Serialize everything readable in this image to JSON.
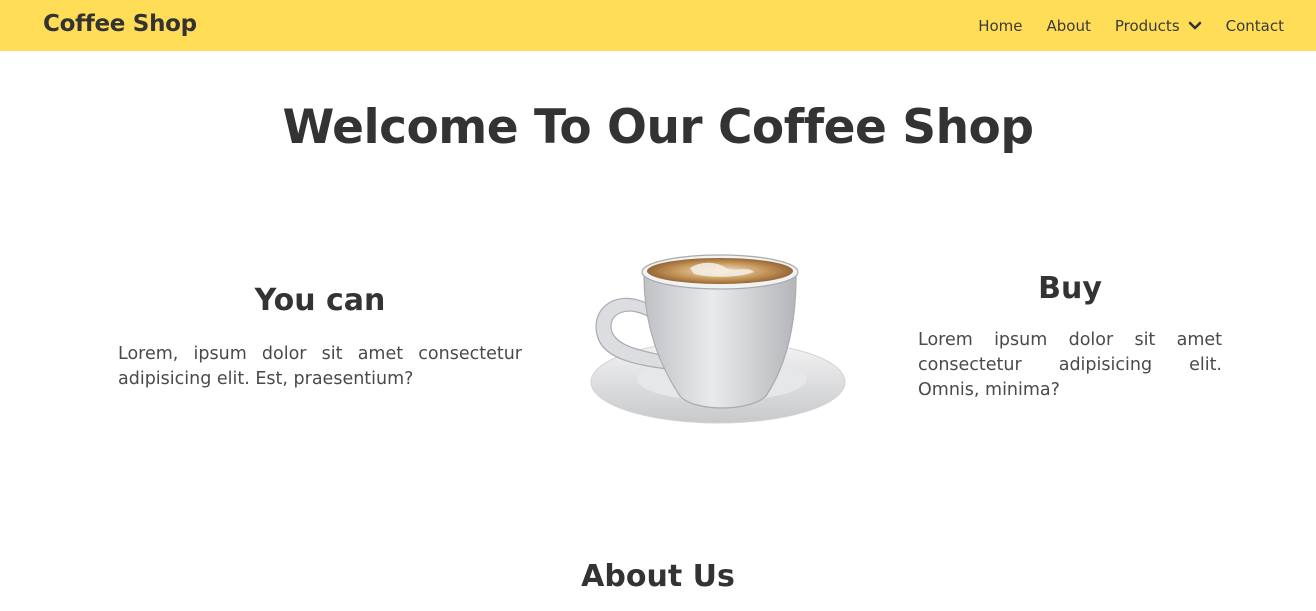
{
  "nav": {
    "brand": "Coffee Shop",
    "links": [
      {
        "label": "Home"
      },
      {
        "label": "About"
      },
      {
        "label": "Products",
        "icon": "chevron-down-icon"
      },
      {
        "label": "Contact"
      }
    ]
  },
  "hero": {
    "title": "Welcome To Our Coffee Shop"
  },
  "features": {
    "left": {
      "title": "You can",
      "text": "Lorem, ipsum dolor sit amet consectetur adipisicing elit. Est, praesentium?"
    },
    "right": {
      "title": "Buy",
      "text": "Lorem ipsum dolor sit amet consectetur adipisicing elit. Omnis, minima?"
    },
    "image": "coffee-cup-image"
  },
  "about": {
    "title": "About Us"
  },
  "colors": {
    "navbar": "#ffdd57",
    "text": "#333333",
    "body_text": "#4a4a4a",
    "background": "#ffffff"
  }
}
